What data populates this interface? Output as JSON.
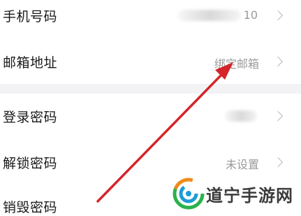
{
  "settings": {
    "rows": [
      {
        "label": "手机号码",
        "value_visible": "10"
      },
      {
        "label": "邮箱地址",
        "value": "绑定邮箱"
      },
      {
        "label": "登录密码"
      },
      {
        "label": "解锁密码",
        "value": "未设置"
      },
      {
        "label": "销毁密码"
      }
    ]
  },
  "watermark": {
    "text": "道宁手游网"
  },
  "colors": {
    "arrow": "#d4252b",
    "divider": "#f3f3f5",
    "value_text": "#9a9a9a"
  }
}
